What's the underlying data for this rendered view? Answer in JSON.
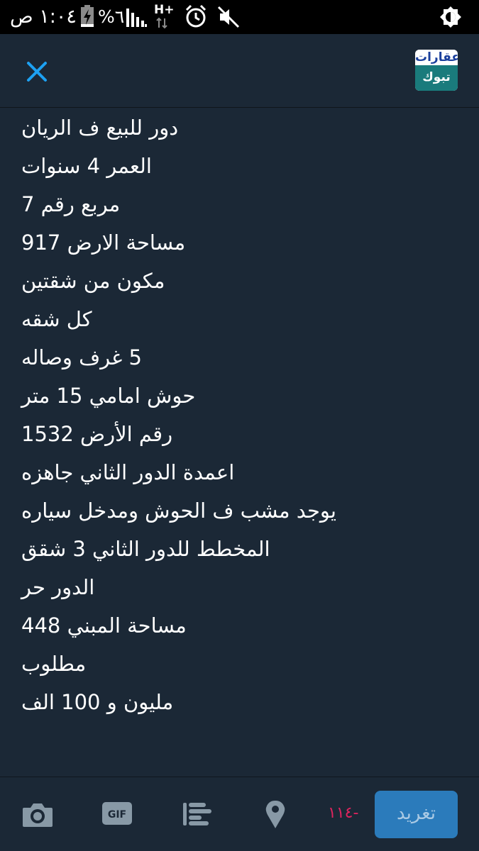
{
  "status_bar": {
    "time": "١:٠٤ ص",
    "battery_percent": "%٦",
    "network": "H+",
    "icons": [
      "battery-charging-icon",
      "signal-icon",
      "hplus-icon",
      "alarm-icon",
      "mute-icon",
      "brightness-icon"
    ]
  },
  "header": {
    "close_icon": "close-icon",
    "avatar_top_text": "عقارات",
    "avatar_bottom_text": "تبوك"
  },
  "tweet": {
    "lines": [
      "دور للبيع ف الريان",
      "العمر 4 سنوات",
      "مربع رقم 7",
      "مساحة الارض 917",
      "مكون من شقتين",
      "كل شقه",
      "5 غرف وصاله",
      "حوش امامي 15 متر",
      "رقم الأرض 1532",
      "اعمدة الدور الثاني جاهزه",
      "يوجد مشب ف الحوش ومدخل سياره",
      "المخطط للدور الثاني 3 شقق",
      "الدور حر",
      "مساحة المبني 448",
      " مطلوب",
      "مليون و 100 الف"
    ]
  },
  "toolbar": {
    "icons": [
      "camera-icon",
      "gif-icon",
      "poll-icon",
      "location-icon"
    ],
    "gif_label": "GIF",
    "char_count": "١١٤-",
    "tweet_button_label": "تغريد"
  },
  "colors": {
    "background": "#1b2836",
    "status_bar": "#000000",
    "accent": "#1da1f2",
    "tweet_button": "#2b7bbb",
    "char_count": "#e0245e",
    "icon": "#8899a6"
  }
}
